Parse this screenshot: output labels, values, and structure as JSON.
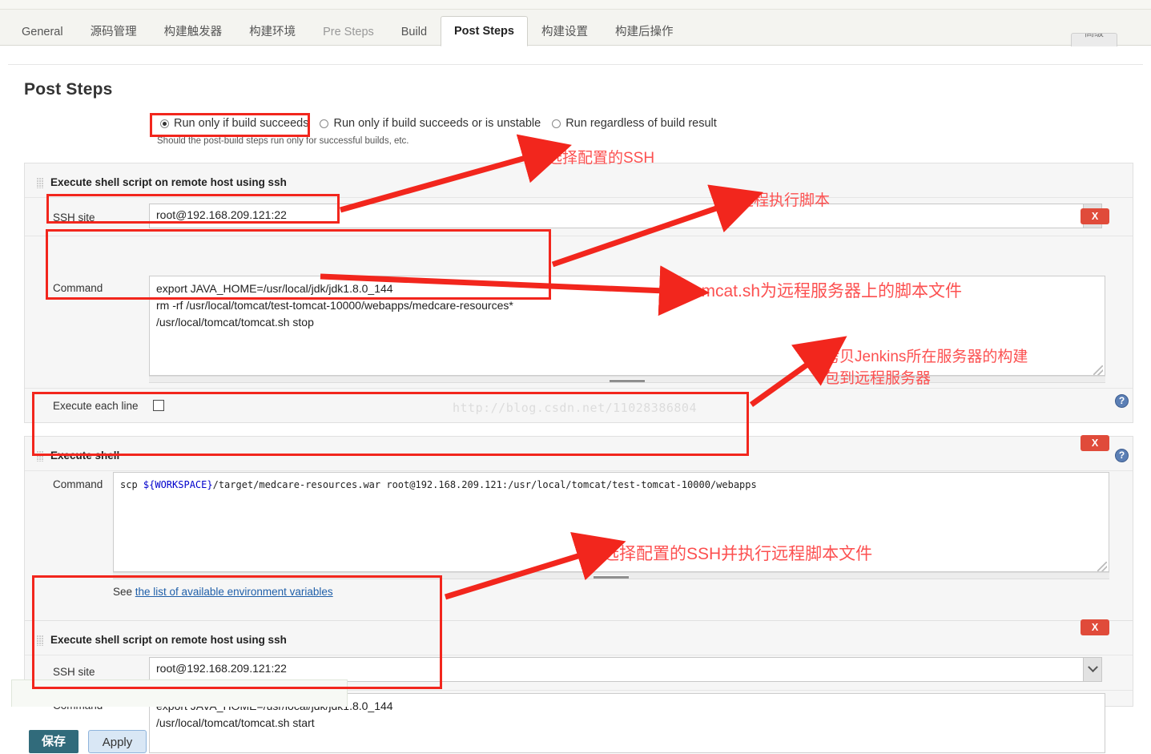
{
  "tabs": [
    {
      "label": "General",
      "active": false,
      "dim": true
    },
    {
      "label": "源码管理",
      "active": false,
      "dim": true
    },
    {
      "label": "构建触发器",
      "active": false,
      "dim": true
    },
    {
      "label": "构建环境",
      "active": false,
      "dim": true
    },
    {
      "label": "Pre Steps",
      "active": false,
      "dim": true
    },
    {
      "label": "Build",
      "active": false,
      "dim": false
    },
    {
      "label": "Post Steps",
      "active": true,
      "dim": false
    },
    {
      "label": "构建设置",
      "active": false,
      "dim": true
    },
    {
      "label": "构建后操作",
      "active": false,
      "dim": true
    }
  ],
  "top_right_button": "高级",
  "page": {
    "title": "Post Steps"
  },
  "run_condition": {
    "options": [
      {
        "label": "Run only if build succeeds",
        "selected": true
      },
      {
        "label": "Run only if build succeeds or is unstable",
        "selected": false
      },
      {
        "label": "Run regardless of build result",
        "selected": false
      }
    ],
    "help_text": "Should the post-build steps run only for successful builds, etc."
  },
  "blocks": [
    {
      "title": "Execute shell script on remote host using ssh",
      "ssh_site_label": "SSH site",
      "ssh_site_value": "root@192.168.209.121:22",
      "command_label": "Command",
      "command_value": "export JAVA_HOME=/usr/local/jdk/jdk1.8.0_144\nrm -rf /usr/local/tomcat/test-tomcat-10000/webapps/medcare-resources*\n/usr/local/tomcat/tomcat.sh stop",
      "execute_each_line_label": "Execute each line",
      "execute_each_line_checked": false,
      "close_label": "X",
      "help_label": "?"
    },
    {
      "title": "Execute shell",
      "command_label": "Command",
      "command_prefix": "scp ",
      "command_var": "${WORKSPACE}",
      "command_suffix": "/target/medcare-resources.war root@192.168.209.121:/usr/local/tomcat/test-tomcat-10000/webapps",
      "env_see_text": "See ",
      "env_link_text": "the list of available environment variables",
      "close_label": "X",
      "help_label": "?"
    },
    {
      "title": "Execute shell script on remote host using ssh",
      "ssh_site_label": "SSH site",
      "ssh_site_value": "root@192.168.209.121:22",
      "command_label": "Command",
      "command_value": "export JAVA_HOME=/usr/local/jdk/jdk1.8.0_144\n/usr/local/tomcat/tomcat.sh start",
      "close_label": "X"
    }
  ],
  "annotations": [
    {
      "text": "选择配置的SSH"
    },
    {
      "text": "远程执行脚本"
    },
    {
      "text": "tomcat.sh为远程服务器上的脚本文件"
    },
    {
      "text": "拷贝Jenkins所在服务器的构建"
    },
    {
      "text": "包到远程服务器"
    },
    {
      "text": "选择配置的SSH并执行远程脚本文件"
    }
  ],
  "watermark": "http://blog.csdn.net/11028386804",
  "footer": {
    "save_label": "保存",
    "apply_label": "Apply"
  },
  "colors": {
    "annotation_red": "#fc5050",
    "box_red": "#f2261d",
    "close_red": "#e04b3a",
    "save_teal": "#316b7b",
    "link_blue": "#1f5fa9",
    "var_blue": "#0000cc"
  }
}
